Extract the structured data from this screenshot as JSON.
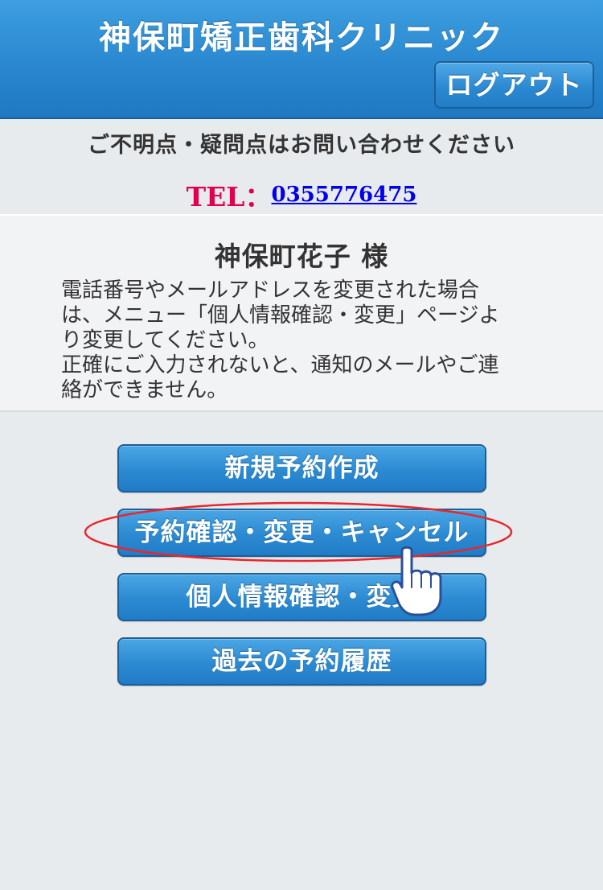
{
  "header": {
    "clinic_name": "神保町矯正歯科クリニック",
    "logout_label": "ログアウト"
  },
  "contact": {
    "message": "ご不明点・疑問点はお問い合わせください",
    "tel_label": "TEL：",
    "tel_number": "0355776475"
  },
  "user": {
    "name": "神保町花子 様",
    "notice_line1": "電話番号やメールアドレスを変更された場合",
    "notice_line2": "は、メニュー「個人情報確認・変更」ページよ",
    "notice_line3": "り変更してください。",
    "notice_line4": "正確にご入力されないと、通知のメールやご連",
    "notice_line5": "絡ができません。"
  },
  "menu": {
    "new_reservation": "新規予約作成",
    "confirm_change_cancel": "予約確認・変更・キャンセル",
    "personal_info": "個人情報確認・変更",
    "history": "過去の予約履歴"
  },
  "colors": {
    "header_blue": "#2a88d0",
    "button_blue": "#2c8ad2",
    "tel_red": "#e0004f",
    "link_blue": "#0000ee",
    "highlight_red": "#e8262c"
  },
  "icons": {
    "pointer": "hand-pointer-icon"
  }
}
